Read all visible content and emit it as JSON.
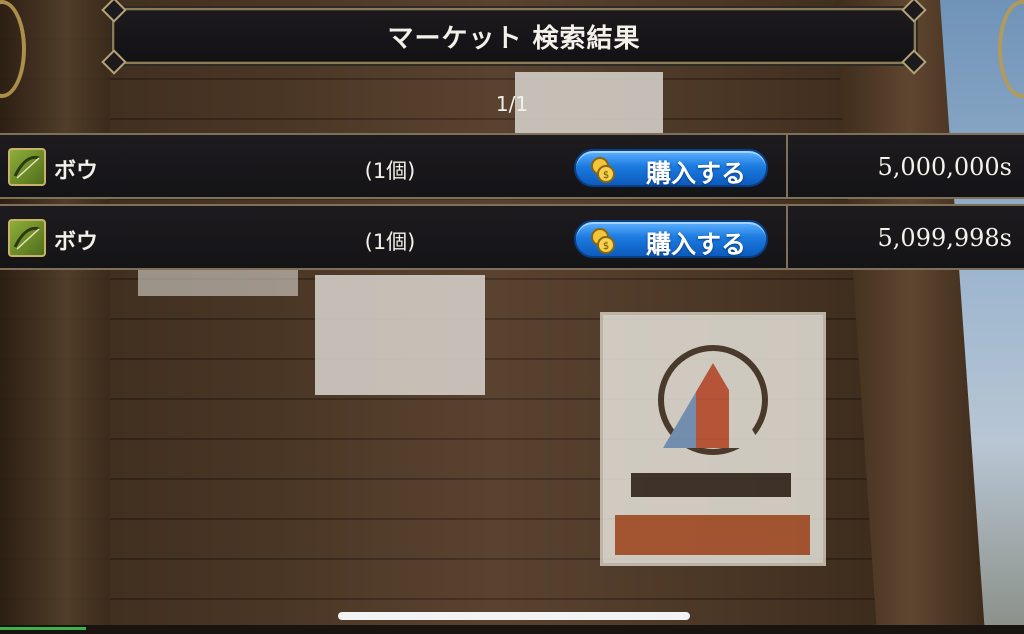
{
  "title": "マーケット 検索結果",
  "pagination": "1/1",
  "results": [
    {
      "name": "ボウ",
      "quantity": "(1個)",
      "buy_label": "購入する",
      "price": "5,000,000s",
      "icon": "bow-icon"
    },
    {
      "name": "ボウ",
      "quantity": "(1個)",
      "buy_label": "購入する",
      "price": "5,099,998s",
      "icon": "bow-icon"
    }
  ],
  "colors": {
    "button_blue": "#1c7be0",
    "frame_gold": "#8c7a58",
    "panel_dark": "#1a181b"
  }
}
